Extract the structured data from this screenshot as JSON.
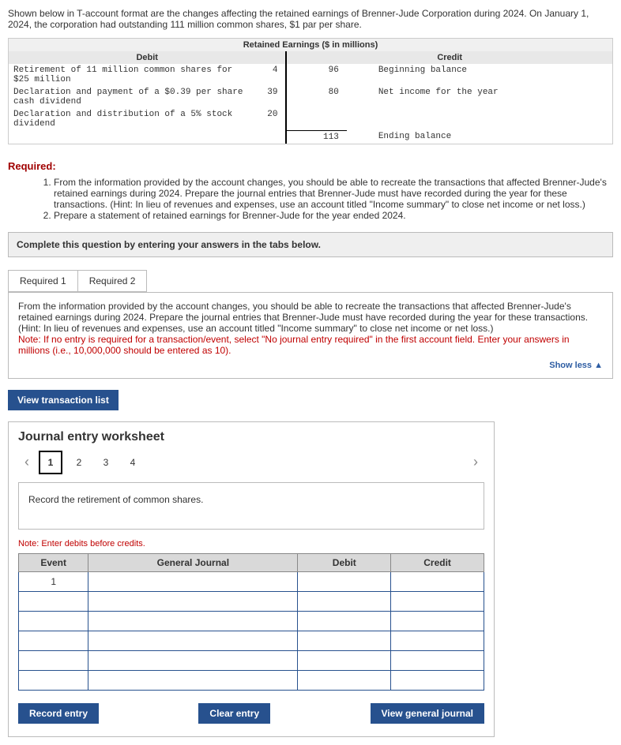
{
  "intro": "Shown below in T-account format are the changes affecting the retained earnings of Brenner-Jude Corporation during 2024. On January 1, 2024, the corporation had outstanding 111 million common shares, $1 par per share.",
  "t_account": {
    "title": "Retained Earnings ($ in millions)",
    "debit_header": "Debit",
    "credit_header": "Credit",
    "debit_rows": [
      {
        "desc": "Retirement of 11 million common shares for $25 million",
        "amount": "4"
      },
      {
        "desc": "Declaration and payment of a $0.39 per share cash dividend",
        "amount": "39"
      },
      {
        "desc": "Declaration and distribution of a 5% stock dividend",
        "amount": "20"
      }
    ],
    "credit_rows": [
      {
        "amount": "96",
        "desc": "Beginning balance"
      },
      {
        "amount": "80",
        "desc": "Net income for the year"
      }
    ],
    "ending": {
      "amount": "113",
      "desc": "Ending balance"
    }
  },
  "required_header": "Required:",
  "required_items": [
    "From the information provided by the account changes, you should be able to recreate the transactions that affected Brenner-Jude's retained earnings during 2024. Prepare the journal entries that Brenner-Jude must have recorded during the year for these transactions. (Hint: In lieu of revenues and expenses, use an account titled \"Income summary\" to close net income or net loss.)",
    "Prepare a statement of retained earnings for Brenner-Jude for the year ended 2024."
  ],
  "complete_instruction": "Complete this question by entering your answers in the tabs below.",
  "tabs": {
    "r1": "Required 1",
    "r2": "Required 2"
  },
  "instruction_box": {
    "main": "From the information provided by the account changes, you should be able to recreate the transactions that affected Brenner-Jude's retained earnings during 2024. Prepare the journal entries that Brenner-Jude must have recorded during the year for these transactions. (Hint: In lieu of revenues and expenses, use an account titled \"Income summary\" to close net income or net loss.)",
    "note": "Note: If no entry is required for a transaction/event, select \"No journal entry required\" in the first account field. Enter your answers in millions (i.e., 10,000,000 should be entered as 10).",
    "showless": "Show less"
  },
  "view_transaction_list": "View transaction list",
  "journal_entry": {
    "title": "Journal entry worksheet",
    "steps": [
      "1",
      "2",
      "3",
      "4"
    ],
    "record_label": "Record the retirement of common shares.",
    "note": "Note: Enter debits before credits.",
    "headers": {
      "event": "Event",
      "gj": "General Journal",
      "debit": "Debit",
      "credit": "Credit"
    },
    "event_value": "1",
    "actions": {
      "record": "Record entry",
      "clear": "Clear entry",
      "view": "View general journal"
    }
  }
}
